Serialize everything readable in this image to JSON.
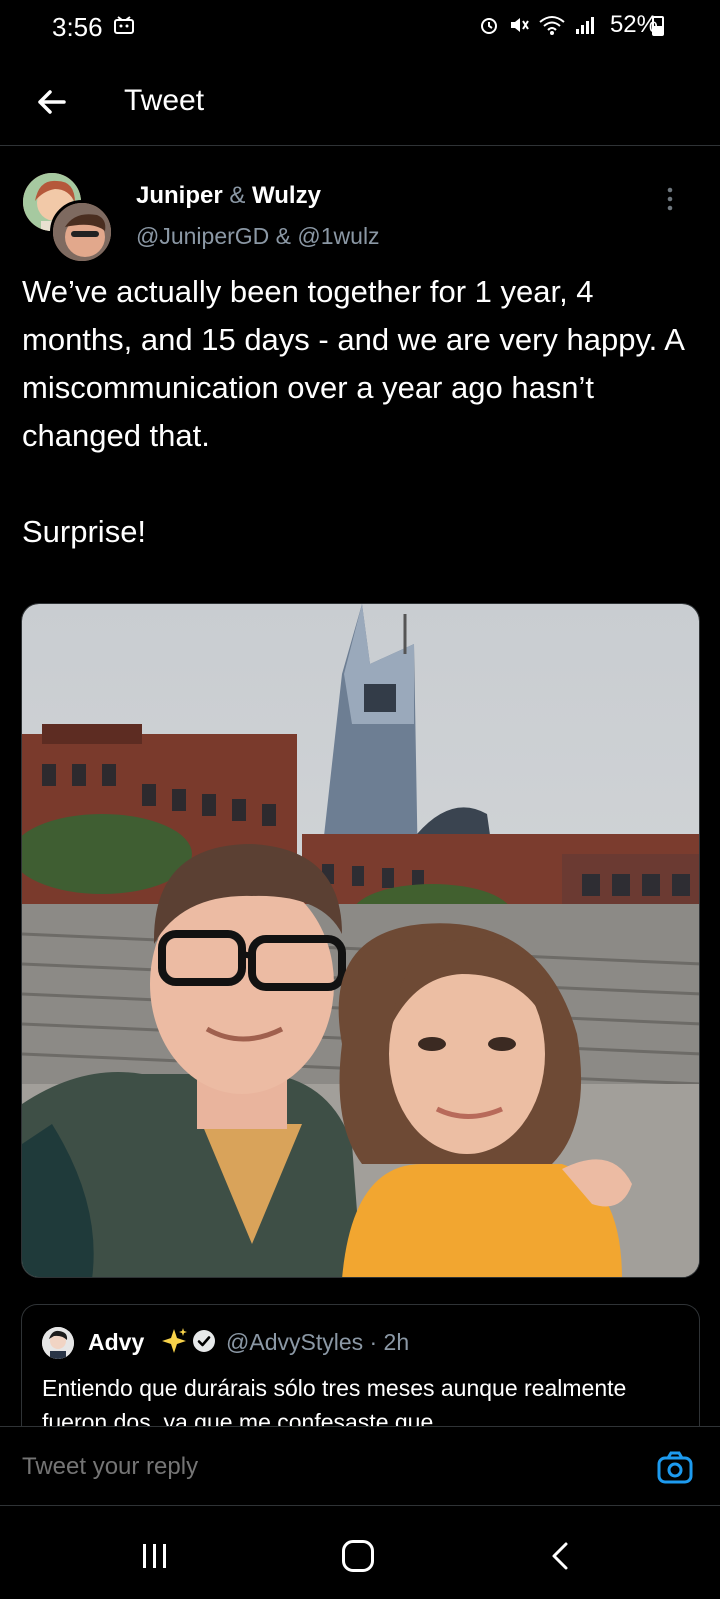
{
  "status_bar": {
    "time": "3:56",
    "battery": "52%"
  },
  "header": {
    "title": "Tweet"
  },
  "tweet": {
    "author_first": "Juniper",
    "author_amp": "&",
    "author_second": "Wulzy",
    "handles": "@JuniperGD & @1wulz",
    "text": "We’ve actually been together for 1 year, 4 months, and 15 days - and we are very happy. A miscommunication over a year ago hasn’t changed that.\n\nSurprise!"
  },
  "quoted_tweet": {
    "name": "Advy",
    "handle_time": "@AdvyStyles · 2h",
    "text": "Entiendo que durárais sólo tres meses aunque realmente fueron dos, ya que me confesaste que"
  },
  "reply": {
    "placeholder": "Tweet your reply"
  },
  "colors": {
    "background": "#000000",
    "accent": "#1d9bf0",
    "secondary_text": "#8b98a5"
  }
}
